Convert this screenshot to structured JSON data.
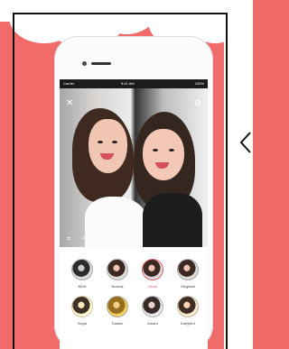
{
  "status_bar": {
    "left": "Carrier",
    "center": "9:41 AM",
    "right": "100%"
  },
  "filters": [
    {
      "label": "B&W"
    },
    {
      "label": "Normal"
    },
    {
      "label": "Moist"
    },
    {
      "label": "Gingham"
    },
    {
      "label": "Sepia"
    },
    {
      "label": "Toaster"
    },
    {
      "label": "Amaro"
    },
    {
      "label": "Earlybird"
    }
  ],
  "colors": {
    "background": "#f06a6a",
    "selected_filter": "#e45e68"
  }
}
